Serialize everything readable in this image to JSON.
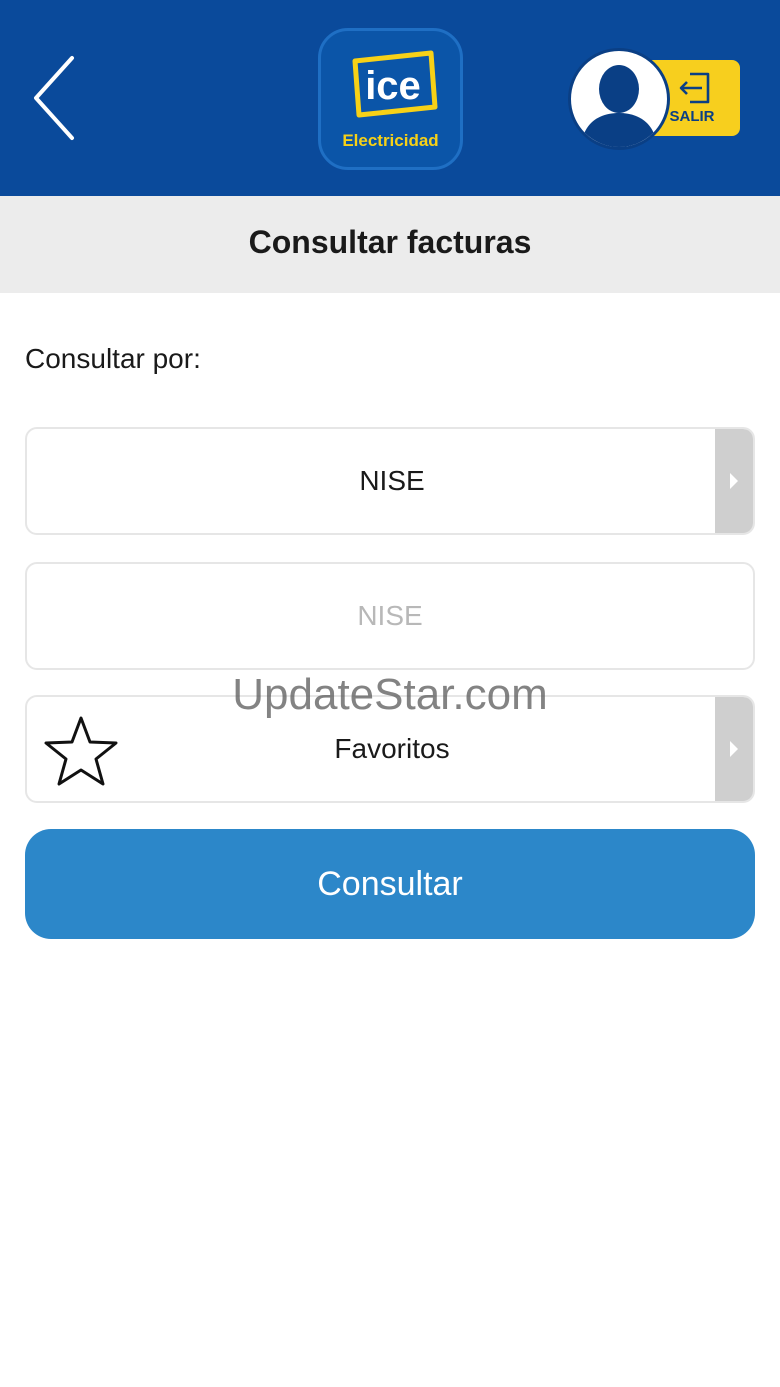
{
  "header": {
    "logo_text": "ice",
    "logo_subtitle": "Electricidad",
    "logout_label": "SALIR",
    "colors": {
      "background": "#0a4a9b",
      "accent": "#f7cf1e"
    }
  },
  "page": {
    "title": "Consultar facturas"
  },
  "form": {
    "prompt": "Consultar por:",
    "type_select_value": "NISE",
    "nise_placeholder": "NISE",
    "favorites_label": "Favoritos",
    "submit_label": "Consultar",
    "submit_color": "#2c87c9"
  },
  "icons": {
    "back": "chevron-left-icon",
    "user": "user-avatar-icon",
    "logout": "logout-icon",
    "favorite": "star-outline-icon",
    "dropdown": "caret-right-icon"
  },
  "watermark": "UpdateStar.com"
}
